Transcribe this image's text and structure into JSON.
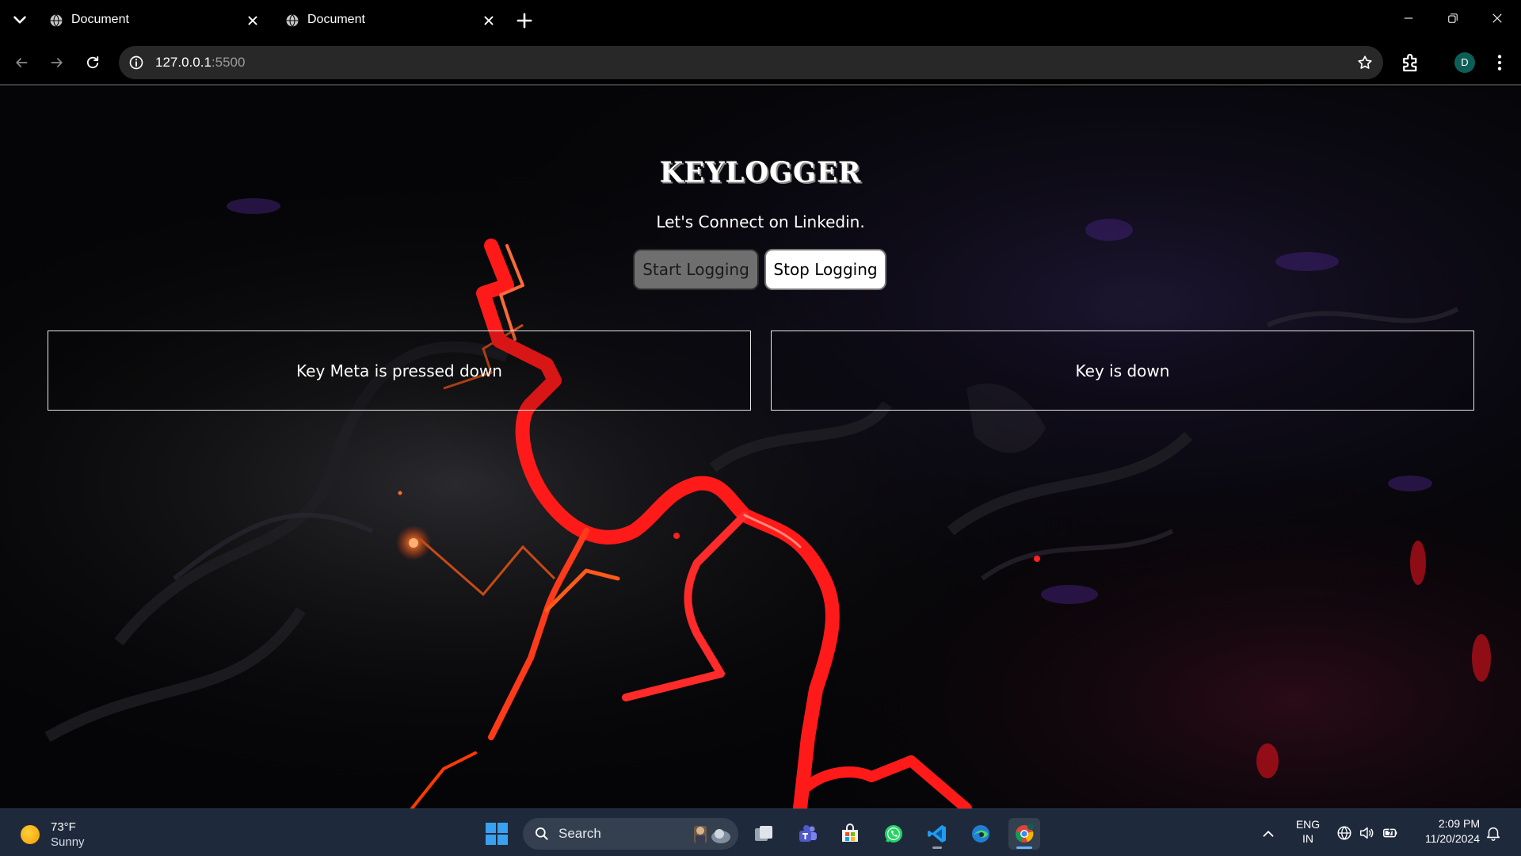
{
  "browser": {
    "tabs": [
      {
        "title": "Document"
      },
      {
        "title": "Document"
      }
    ],
    "url_host": "127.0.0.1",
    "url_port": ":5500",
    "profile_initial": "D"
  },
  "page": {
    "title": "KEYLOGGER",
    "subtitle": "Let's Connect on Linkedin.",
    "start_button": "Start Logging",
    "stop_button": "Stop Logging",
    "log_left": "Key Meta is pressed down",
    "log_right": "Key is down"
  },
  "taskbar": {
    "weather_temp": "73°F",
    "weather_condition": "Sunny",
    "search_label": "Search",
    "lang_line1": "ENG",
    "lang_line2": "IN",
    "time": "2:09 PM",
    "date": "11/20/2024"
  },
  "icons": {
    "tab_menu": "chevron-down-icon",
    "favicon": "globe-icon",
    "tab_close": "close-icon",
    "new_tab": "plus-icon",
    "minimize": "minimize-icon",
    "restore": "restore-icon",
    "close_window": "close-icon",
    "back": "arrow-left-icon",
    "forward": "arrow-right-icon",
    "reload": "reload-icon",
    "site_info": "info-icon",
    "bookmark": "star-icon",
    "extensions": "puzzle-icon",
    "menu": "kebab-icon"
  },
  "colors": {
    "lightning": "#ff1a1a",
    "taskbar": "#1e2a3c",
    "avatar": "#0e5e58"
  }
}
